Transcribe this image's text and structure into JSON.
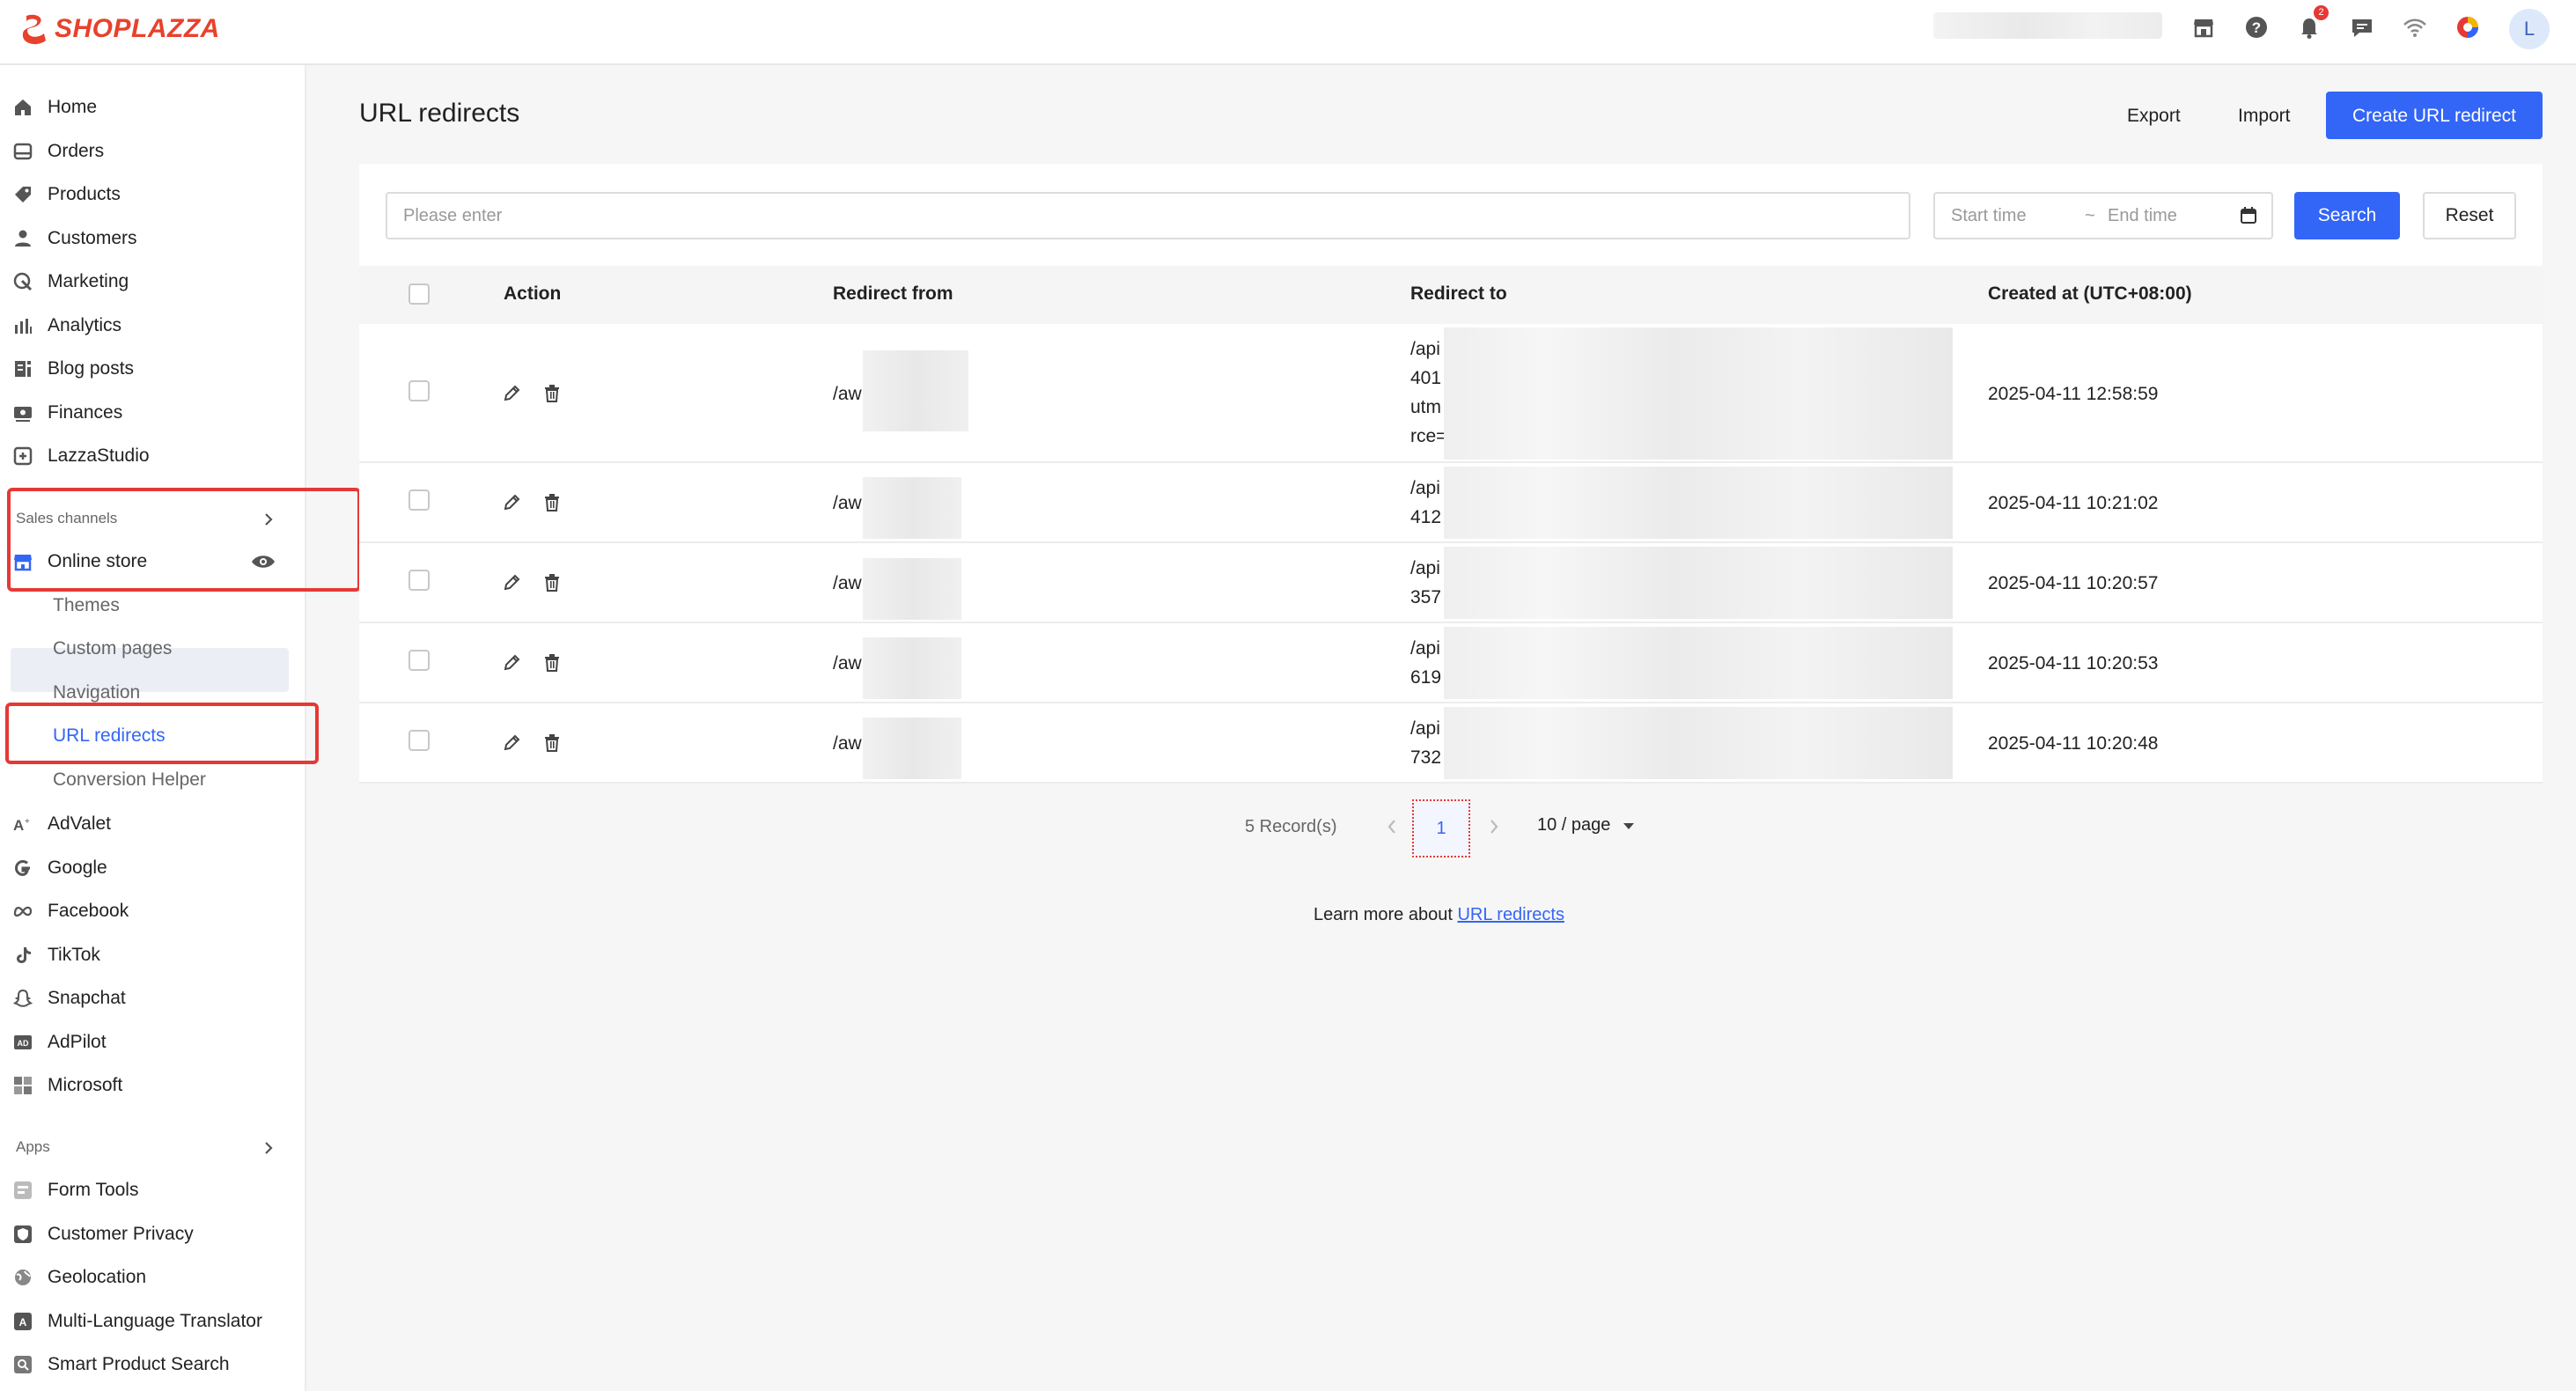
{
  "brand": {
    "name": "SHOPLAZZA",
    "color": "#e8412c"
  },
  "topbar": {
    "icons": [
      "store-icon",
      "help-icon",
      "bell-icon",
      "chat-icon",
      "wifi-icon",
      "color-wheel-icon"
    ],
    "notification_count": "2",
    "avatar_letter": "L"
  },
  "sidebar": {
    "items": [
      {
        "label": "Home",
        "icon": "home-icon"
      },
      {
        "label": "Orders",
        "icon": "orders-icon"
      },
      {
        "label": "Products",
        "icon": "tag-icon"
      },
      {
        "label": "Customers",
        "icon": "person-icon"
      },
      {
        "label": "Marketing",
        "icon": "marketing-icon"
      },
      {
        "label": "Analytics",
        "icon": "bar-chart-icon"
      },
      {
        "label": "Blog posts",
        "icon": "blog-icon"
      },
      {
        "label": "Finances",
        "icon": "finance-icon"
      },
      {
        "label": "LazzaStudio",
        "icon": "studio-icon"
      }
    ],
    "sales_channels_label": "Sales channels",
    "online_store_label": "Online store",
    "online_store_sub": [
      "Themes",
      "Custom pages",
      "Navigation",
      "URL redirects",
      "Conversion Helper"
    ],
    "channels": [
      {
        "label": "AdValet",
        "icon": "advalet-icon"
      },
      {
        "label": "Google",
        "icon": "google-icon"
      },
      {
        "label": "Facebook",
        "icon": "meta-icon"
      },
      {
        "label": "TikTok",
        "icon": "tiktok-icon"
      },
      {
        "label": "Snapchat",
        "icon": "snapchat-icon"
      },
      {
        "label": "AdPilot",
        "icon": "adpilot-icon"
      },
      {
        "label": "Microsoft",
        "icon": "microsoft-icon"
      }
    ],
    "apps_label": "Apps",
    "apps": [
      {
        "label": "Form Tools",
        "icon": "form-icon"
      },
      {
        "label": "Customer Privacy",
        "icon": "shield-icon"
      },
      {
        "label": "Geolocation",
        "icon": "globe-icon"
      },
      {
        "label": "Multi-Language Translator",
        "icon": "translate-icon"
      },
      {
        "label": "Smart Product Search",
        "icon": "search-app-icon"
      }
    ]
  },
  "page": {
    "title": "URL redirects",
    "export_label": "Export",
    "import_label": "Import",
    "create_label": "Create URL redirect"
  },
  "filters": {
    "search_placeholder": "Please enter",
    "start_time": "Start time",
    "separator": "~",
    "end_time": "End time",
    "search_label": "Search",
    "reset_label": "Reset"
  },
  "table": {
    "columns": [
      "Action",
      "Redirect from",
      "Redirect to",
      "Created at (UTC+08:00)"
    ],
    "rows": [
      {
        "from": "/aw",
        "to": [
          "/api",
          "401",
          "utm",
          "rce="
        ],
        "created": "2025-04-11 12:58:59"
      },
      {
        "from": "/aw",
        "to": [
          "/api",
          "412"
        ],
        "created": "2025-04-11 10:21:02"
      },
      {
        "from": "/aw",
        "to": [
          "/api",
          "357"
        ],
        "created": "2025-04-11 10:20:57"
      },
      {
        "from": "/aw",
        "to": [
          "/api",
          "619"
        ],
        "created": "2025-04-11 10:20:53"
      },
      {
        "from": "/aw",
        "to": [
          "/api",
          "732"
        ],
        "created": "2025-04-11 10:20:48"
      }
    ]
  },
  "pagination": {
    "records": "5 Record(s)",
    "current_page": "1",
    "page_size": "10 / page"
  },
  "footer": {
    "learn_prefix": "Learn more about",
    "learn_link": "URL redirects"
  },
  "colors": {
    "accent": "#3366f6",
    "highlight": "#e53935"
  }
}
